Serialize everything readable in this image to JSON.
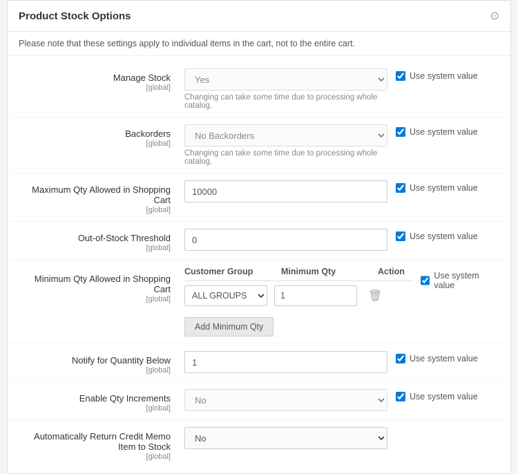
{
  "panel": {
    "title": "Product Stock Options",
    "note": "Please note that these settings apply to individual items in the cart, not to the entire cart.",
    "collapse_icon": "⊙"
  },
  "fields": {
    "manage_stock": {
      "label": "Manage Stock",
      "global": "[global]",
      "value": "Yes",
      "hint": "Changing can take some time due to processing whole catalog.",
      "system_label": "Use system value"
    },
    "backorders": {
      "label": "Backorders",
      "global": "[global]",
      "value": "No Backorders",
      "hint": "Changing can take some time due to processing whole catalog.",
      "system_label": "Use system value"
    },
    "max_qty": {
      "label": "Maximum Qty Allowed in Shopping Cart",
      "global": "[global]",
      "value": "10000",
      "system_label": "Use system value"
    },
    "out_of_stock": {
      "label": "Out-of-Stock Threshold",
      "global": "[global]",
      "value": "0",
      "system_label": "Use system value"
    },
    "min_qty": {
      "label": "Minimum Qty Allowed in Shopping Cart",
      "global": "[global]",
      "system_label": "Use system value",
      "table": {
        "col_group": "Customer Group",
        "col_minqty": "Minimum Qty",
        "col_action": "Action"
      },
      "rows": [
        {
          "group": "ALL GROUPS",
          "qty": "1"
        }
      ],
      "add_button": "Add Minimum Qty"
    },
    "notify_below": {
      "label": "Notify for Quantity Below",
      "global": "[global]",
      "value": "1",
      "system_label": "Use system value"
    },
    "enable_qty_increments": {
      "label": "Enable Qty Increments",
      "global": "[global]",
      "value": "No",
      "system_label": "Use system value"
    },
    "auto_return": {
      "label": "Automatically Return Credit Memo Item to Stock",
      "global": "[global]",
      "value": "No"
    }
  }
}
